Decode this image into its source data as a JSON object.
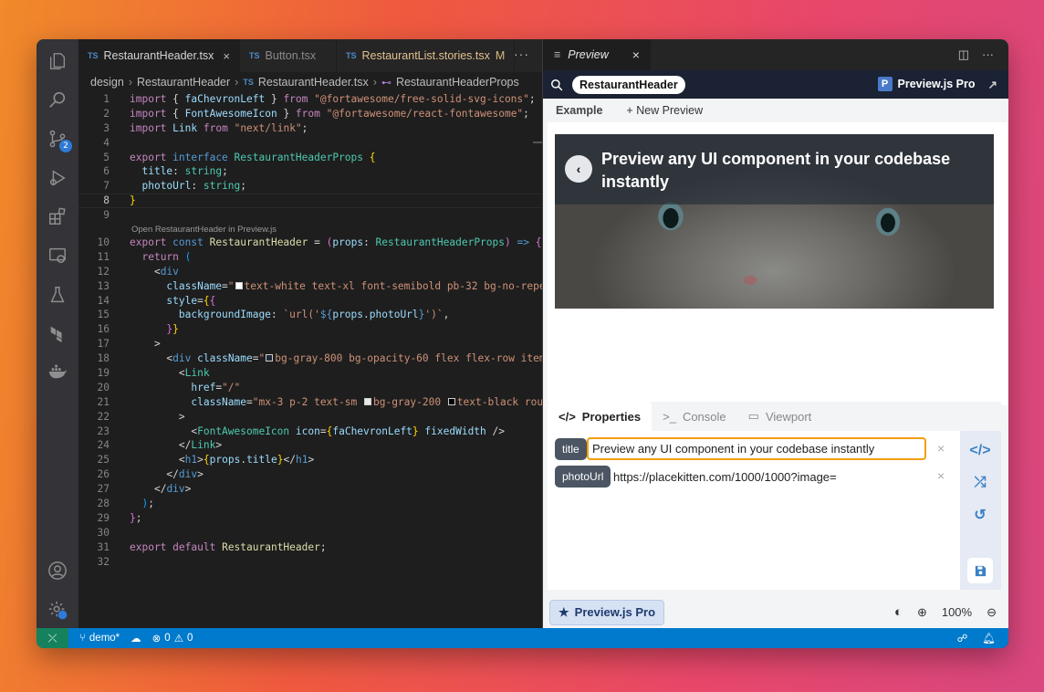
{
  "activity_bar": {
    "scm_badge": "2"
  },
  "editor": {
    "tabs": [
      {
        "label": "RestaurantHeader.tsx",
        "lang": "TS",
        "active": true,
        "close": "×"
      },
      {
        "label": "Button.tsx",
        "lang": "TS",
        "active": false
      },
      {
        "label": "RestaurantList.stories.tsx",
        "lang": "TS",
        "active": false,
        "modified": "M"
      }
    ],
    "tabs_more": "···",
    "breadcrumb": {
      "part1": "design",
      "part2": "RestaurantHeader",
      "lang": "TS",
      "part3": "RestaurantHeader.tsx",
      "part4": "RestaurantHeaderProps"
    },
    "codelens": "Open RestaurantHeader in Preview.js"
  },
  "preview": {
    "tab_title": "Preview",
    "tab_close": "×",
    "component_name": "RestaurantHeader",
    "pro_label": "Preview.js Pro",
    "example_label": "Example",
    "new_preview_label": "+ New Preview",
    "hero_title": "Preview any UI component in your codebase instantly",
    "bottom_tabs": {
      "properties": "Properties",
      "console": "Console",
      "viewport": "Viewport"
    },
    "props": {
      "title_label": "title",
      "title_value": "Preview any UI component in your codebase instantly",
      "photo_label": "photoUrl",
      "photo_value": "https://placekitten.com/1000/1000?image="
    },
    "footer": {
      "pro_button": "Preview.js Pro",
      "zoom": "100%"
    }
  },
  "status_bar": {
    "branch": "demo*",
    "errors": "0",
    "warnings": "0"
  }
}
